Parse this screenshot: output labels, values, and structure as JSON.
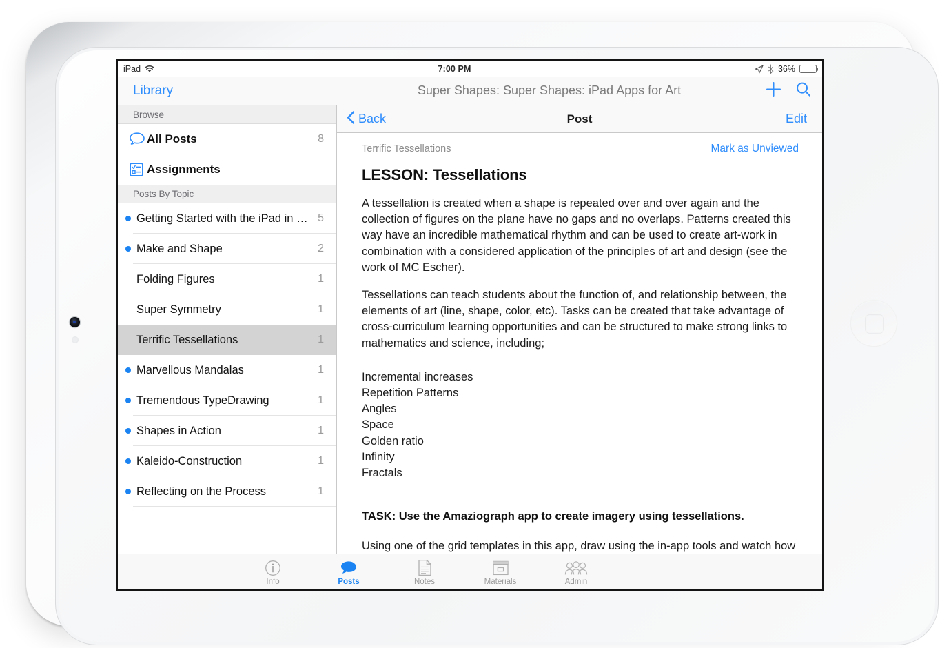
{
  "device": {
    "type": "ipad",
    "orientation": "landscape"
  },
  "status_bar": {
    "device_label": "iPad",
    "wifi_icon": "wifi-icon",
    "time": "7:00 PM",
    "location_icon": "location-arrow-icon",
    "bluetooth_icon": "bluetooth-icon",
    "battery_percent": "36%",
    "battery_level": 36
  },
  "nav_bar": {
    "library_label": "Library",
    "title": "Super Shapes: Super Shapes: iPad Apps for Art",
    "add_icon": "plus-icon",
    "search_icon": "search-icon"
  },
  "sidebar": {
    "browse_header": "Browse",
    "browse_items": [
      {
        "label": "All Posts",
        "count": "8",
        "icon": "speech-bubble-icon"
      },
      {
        "label": "Assignments",
        "count": "",
        "icon": "checklist-icon"
      }
    ],
    "topics_header": "Posts By Topic",
    "topics": [
      {
        "label": "Getting Started with the iPad in Vis…",
        "count": "5",
        "unread": true,
        "selected": false
      },
      {
        "label": "Make and Shape",
        "count": "2",
        "unread": true,
        "selected": false
      },
      {
        "label": "Folding Figures",
        "count": "1",
        "unread": false,
        "selected": false
      },
      {
        "label": "Super Symmetry",
        "count": "1",
        "unread": false,
        "selected": false
      },
      {
        "label": "Terrific Tessellations",
        "count": "1",
        "unread": false,
        "selected": true
      },
      {
        "label": "Marvellous Mandalas",
        "count": "1",
        "unread": true,
        "selected": false
      },
      {
        "label": "Tremendous TypeDrawing",
        "count": "1",
        "unread": true,
        "selected": false
      },
      {
        "label": "Shapes in Action",
        "count": "1",
        "unread": true,
        "selected": false
      },
      {
        "label": "Kaleido-Construction",
        "count": "1",
        "unread": true,
        "selected": false
      },
      {
        "label": "Reflecting on the Process",
        "count": "1",
        "unread": true,
        "selected": false
      }
    ]
  },
  "detail": {
    "back_label": "Back",
    "back_icon": "chevron-left-icon",
    "title": "Post",
    "edit_label": "Edit",
    "post_topic": "Terrific Tessellations",
    "mark_unviewed_label": "Mark as Unviewed",
    "heading": "LESSON: Tessellations",
    "paragraph_1": "A tessellation is created when a shape is repeated over and over again and the collection of figures on the plane have no gaps and no overlaps.  Patterns created this way have an incredible mathematical rhythm and can be used to create art-work in combination with a considered application of the principles of art and design (see the work of MC Escher).",
    "paragraph_2": "Tessellations can teach students about the function of, and relationship between, the elements of art (line, shape, color, etc).  Tasks can be created that take advantage of cross-curriculum learning opportunities and can be structured to make strong links to mathematics and science, including;",
    "list_items": [
      "Incremental increases",
      "Repetition Patterns",
      "Angles",
      "Space",
      "Golden ratio",
      "Infinity",
      "Fractals"
    ],
    "task_line": "TASK:  Use the Amaziograph app to create imagery using tessellations.",
    "paragraph_3": "Using one of the grid templates in this app, draw using the in-app tools and watch how"
  },
  "tab_bar": {
    "active_index": 1,
    "tabs": [
      {
        "label": "Info",
        "icon": "info-circle-icon"
      },
      {
        "label": "Posts",
        "icon": "speech-bubble-filled-icon"
      },
      {
        "label": "Notes",
        "icon": "document-lines-icon"
      },
      {
        "label": "Materials",
        "icon": "archive-box-icon"
      },
      {
        "label": "Admin",
        "icon": "people-group-icon"
      }
    ]
  },
  "colors": {
    "accent_blue": "#1b84f2",
    "link_blue": "#2f8dfc",
    "section_header_bg": "#efeff0",
    "selected_row_bg": "#d3d3d3",
    "muted_text": "#9a9a9a"
  }
}
